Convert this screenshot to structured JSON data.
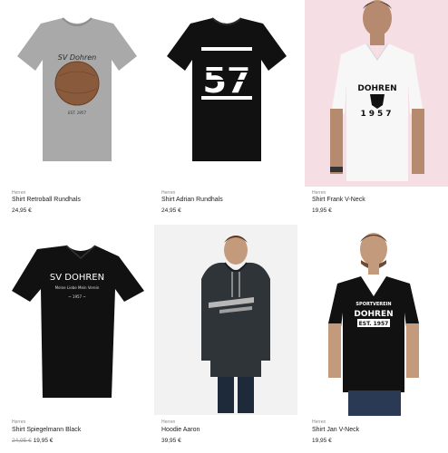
{
  "products": [
    {
      "category": "Herren",
      "name": "Shirt Retroball Rundhals",
      "price": "24,95 €",
      "print_text": "SV Dohren",
      "print_sub": "EST. 1957"
    },
    {
      "category": "Herren",
      "name": "Shirt Adrian Rundhals",
      "price": "24,95 €",
      "print_text": "57"
    },
    {
      "category": "Herren",
      "name": "Shirt Frank V-Neck",
      "price": "19,95 €",
      "print_text": "DOHREN",
      "print_sub": "1957"
    },
    {
      "category": "Herren",
      "name": "Shirt Spiegelmann Black",
      "old_price": "24,95 €",
      "price": "19,95 €",
      "print_text": "SV DOHREN",
      "print_sub": "Meine Liebe Mein Verein",
      "print_year": "~ 1957 ~"
    },
    {
      "category": "Herren",
      "name": "Hoodie Aaron",
      "price": "39,95 €"
    },
    {
      "category": "Herren",
      "name": "Shirt Jan V-Neck",
      "price": "19,95 €",
      "print_text": "SPORTVEREIN",
      "print_sub": "DOHREN",
      "print_year": "EST. 1957"
    }
  ],
  "colors": {
    "grey_shirt": "#a9a9a9",
    "black_shirt": "#111111",
    "pink_bg": "#f6dfe4",
    "photo_bg": "#f2f2f2"
  }
}
